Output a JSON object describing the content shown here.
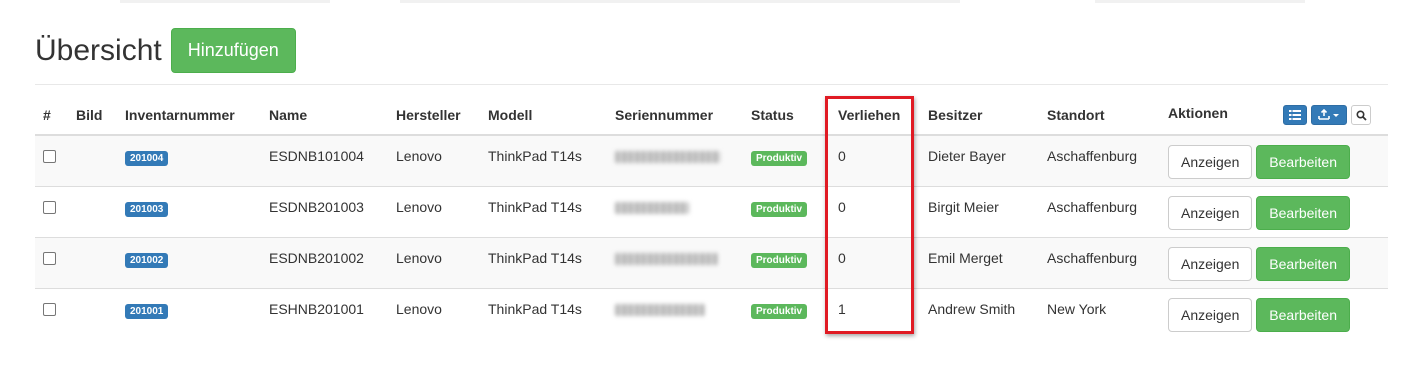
{
  "page": {
    "title": "Übersicht",
    "add_button": "Hinzufügen"
  },
  "colors": {
    "success": "#5cb85c",
    "primary": "#337ab7",
    "highlight": "#e01b24"
  },
  "table": {
    "columns": {
      "hash": "#",
      "bild": "Bild",
      "inventarnummer": "Inventarnummer",
      "name": "Name",
      "hersteller": "Hersteller",
      "modell": "Modell",
      "seriennummer": "Seriennummer",
      "status": "Status",
      "verliehen": "Verliehen",
      "besitzer": "Besitzer",
      "standort": "Standort",
      "aktionen": "Aktionen"
    },
    "toolbar_icons": [
      "list-icon",
      "export-icon",
      "search-icon"
    ],
    "rows": [
      {
        "inventory": "201004",
        "name": "ESDNB101004",
        "manufacturer": "Lenovo",
        "model": "ThinkPad T14s",
        "status": "Produktiv",
        "lent": "0",
        "owner": "Dieter Bayer",
        "location": "Aschaffenburg",
        "view": "Anzeigen",
        "edit": "Bearbeiten"
      },
      {
        "inventory": "201003",
        "name": "ESDNB201003",
        "manufacturer": "Lenovo",
        "model": "ThinkPad T14s",
        "status": "Produktiv",
        "lent": "0",
        "owner": "Birgit Meier",
        "location": "Aschaffenburg",
        "view": "Anzeigen",
        "edit": "Bearbeiten"
      },
      {
        "inventory": "201002",
        "name": "ESDNB201002",
        "manufacturer": "Lenovo",
        "model": "ThinkPad T14s",
        "status": "Produktiv",
        "lent": "0",
        "owner": "Emil Merget",
        "location": "Aschaffenburg",
        "view": "Anzeigen",
        "edit": "Bearbeiten"
      },
      {
        "inventory": "201001",
        "name": "ESHNB201001",
        "manufacturer": "Lenovo",
        "model": "ThinkPad T14s",
        "status": "Produktiv",
        "lent": "1",
        "owner": "Andrew Smith",
        "location": "New York",
        "view": "Anzeigen",
        "edit": "Bearbeiten"
      }
    ]
  }
}
